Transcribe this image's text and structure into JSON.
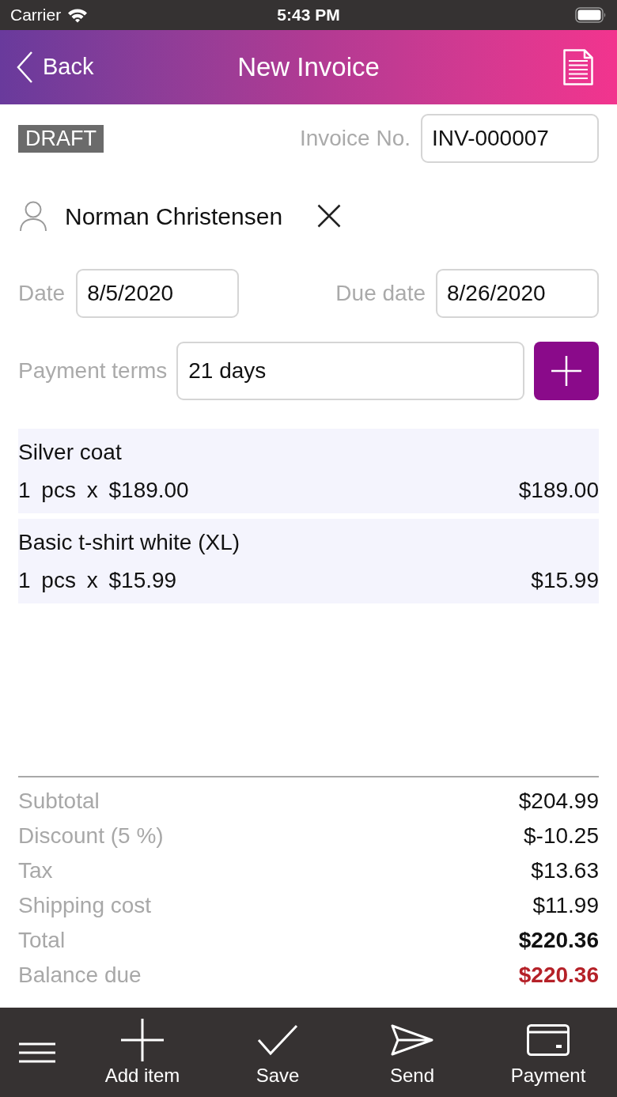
{
  "status_bar": {
    "carrier": "Carrier",
    "time": "5:43 PM"
  },
  "nav_bar": {
    "back": "Back",
    "title": "New Invoice"
  },
  "invoice": {
    "status": "DRAFT",
    "number_label": "Invoice No.",
    "number": "INV-000007"
  },
  "customer": {
    "name": "Norman Christensen"
  },
  "dates": {
    "date_label": "Date",
    "date": "8/5/2020",
    "due_label": "Due date",
    "due": "8/26/2020"
  },
  "payment_terms": {
    "label": "Payment terms",
    "value": "21 days"
  },
  "items": [
    {
      "name": "Silver coat",
      "quantity": "1 pcs x $189.00",
      "amount": "$189.00"
    },
    {
      "name": "Basic t-shirt white (XL)",
      "quantity": "1 pcs x $15.99",
      "amount": "$15.99"
    }
  ],
  "totals": [
    {
      "label": "Subtotal",
      "value": "$204.99",
      "kind": "normal"
    },
    {
      "label": "Discount (5 %)",
      "value": "$-10.25",
      "kind": "normal"
    },
    {
      "label": "Tax",
      "value": "$13.63",
      "kind": "normal"
    },
    {
      "label": "Shipping cost",
      "value": "$11.99",
      "kind": "normal"
    },
    {
      "label": "Total",
      "value": "$220.36",
      "kind": "bold"
    },
    {
      "label": "Balance due",
      "value": "$220.36",
      "kind": "due"
    }
  ],
  "toolbar": [
    {
      "kind": "menu"
    },
    {
      "kind": "add",
      "label": "Add item"
    },
    {
      "kind": "save",
      "label": "Save"
    },
    {
      "kind": "send",
      "label": "Send"
    },
    {
      "kind": "payment",
      "label": "Payment"
    }
  ]
}
